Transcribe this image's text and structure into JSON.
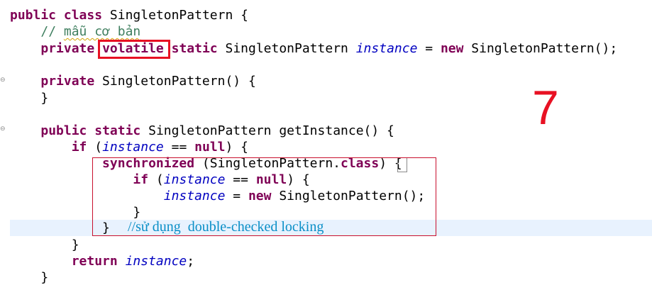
{
  "code": {
    "class_decl": {
      "kw_public": "public",
      "kw_class": "class",
      "name": " SingletonPattern {"
    },
    "comment": {
      "slashes": "// ",
      "text": "mẫu cơ bản"
    },
    "field": {
      "kw_private": "private",
      "kw_volatile": "volatile",
      "kw_static": "static",
      "type": " SingletonPattern ",
      "name": "instance",
      "assign": " = ",
      "kw_new": "new",
      "ctor": " SingletonPattern();"
    },
    "ctor_decl": {
      "kw_private": "private",
      "rest": " SingletonPattern() {"
    },
    "ctor_close": "}",
    "method_decl": {
      "kw_public": "public",
      "kw_static": "static",
      "rest": " SingletonPattern getInstance() {"
    },
    "if_outer": {
      "kw_if": "if",
      "open": " (",
      "name": "instance",
      "op": " == ",
      "kw_null": "null",
      "close": ") {"
    },
    "sync": {
      "kw_synchronized": "synchronized",
      "rest": " (SingletonPattern.",
      "kw_class": "class",
      "close": ") {"
    },
    "if_inner": {
      "kw_if": "if",
      "open": " (",
      "name": "instance",
      "op": " == ",
      "kw_null": "null",
      "close": ") {"
    },
    "assign_line": {
      "name": "instance",
      "assign": " = ",
      "kw_new": "new",
      "ctor": " SingletonPattern();"
    },
    "if_inner_close": "}",
    "sync_close": "}",
    "if_outer_close": "}",
    "return_line": {
      "kw_return": "return",
      "name": "instance",
      "semi": ";"
    },
    "method_close": "}"
  },
  "annotations": {
    "number": "7",
    "note": "//sử dụng  double-checked locking"
  },
  "colors": {
    "keyword": "#7f0055",
    "field": "#0000c0",
    "comment": "#3f7f5f",
    "highlight_box": "#e81123",
    "annotation_text": "#0a8fc7",
    "current_line": "#e8f2fe"
  }
}
